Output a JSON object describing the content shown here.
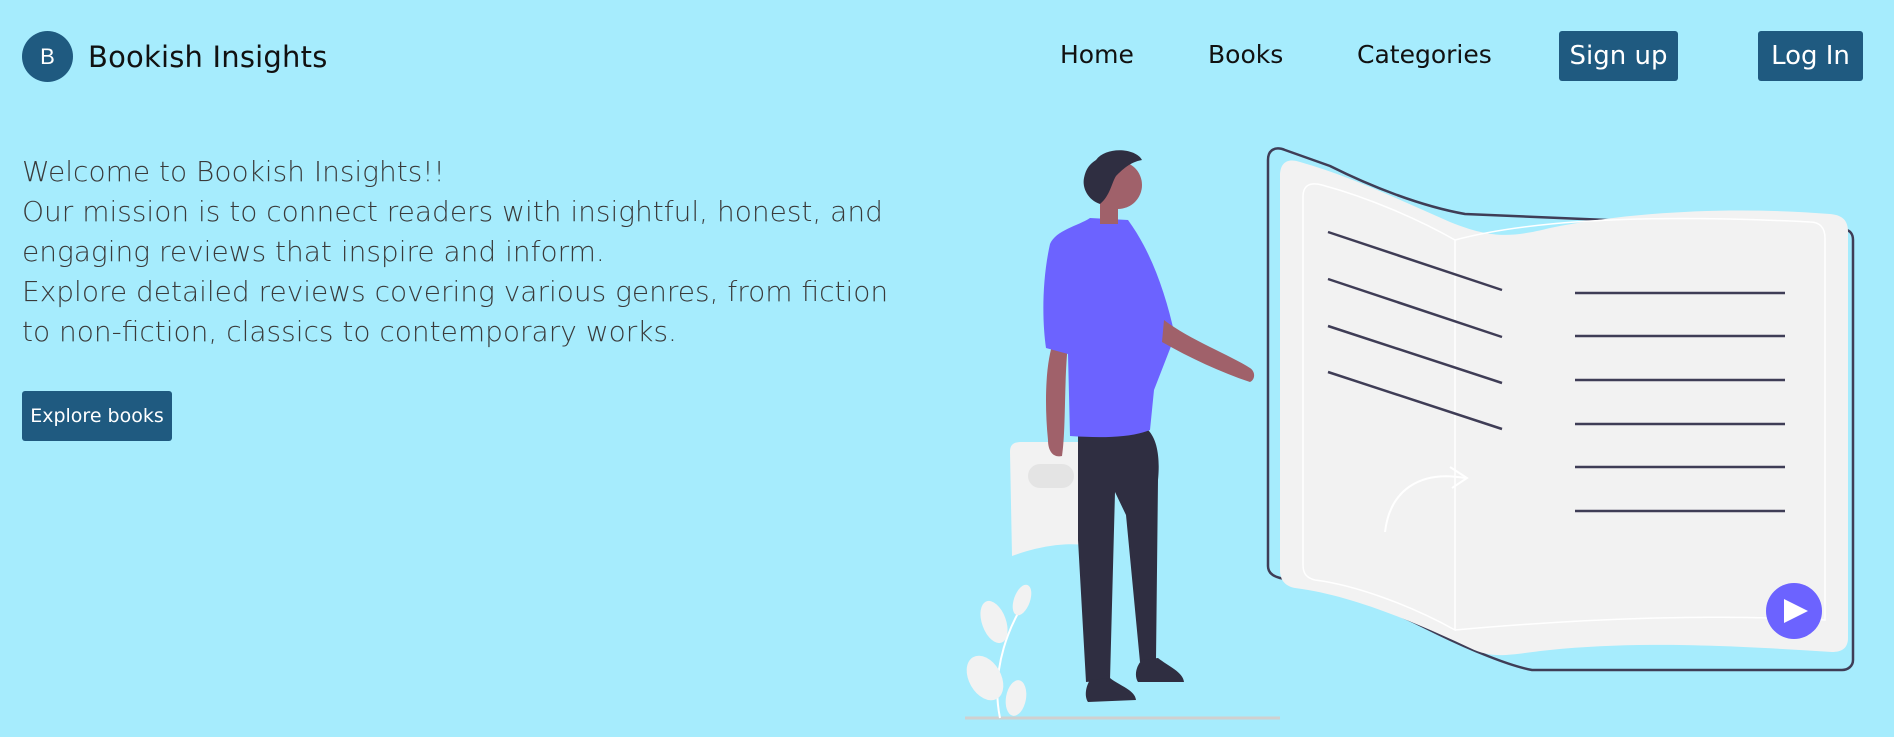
{
  "header": {
    "logo_letter": "B",
    "brand_name": "Bookish Insights",
    "nav": {
      "home": "Home",
      "books": "Books",
      "categories": "Categories",
      "signup": "Sign up",
      "login": "Log In"
    }
  },
  "hero": {
    "line1": "Welcome to Bookish Insights!!",
    "line2": "Our mission is to connect readers with insightful, honest, and engaging reviews that inspire and inform.",
    "line3": "Explore detailed reviews covering various genres, from fiction to non-fiction, classics to contemporary works.",
    "explore_button": "Explore books"
  },
  "colors": {
    "background": "#a6ecfd",
    "primary": "#1f5a80",
    "accent": "#6c63ff",
    "dark": "#2f2e41"
  },
  "illustration": {
    "icons": [
      "reader-person-illustration",
      "open-book-illustration",
      "plant-illustration",
      "play-icon"
    ]
  }
}
